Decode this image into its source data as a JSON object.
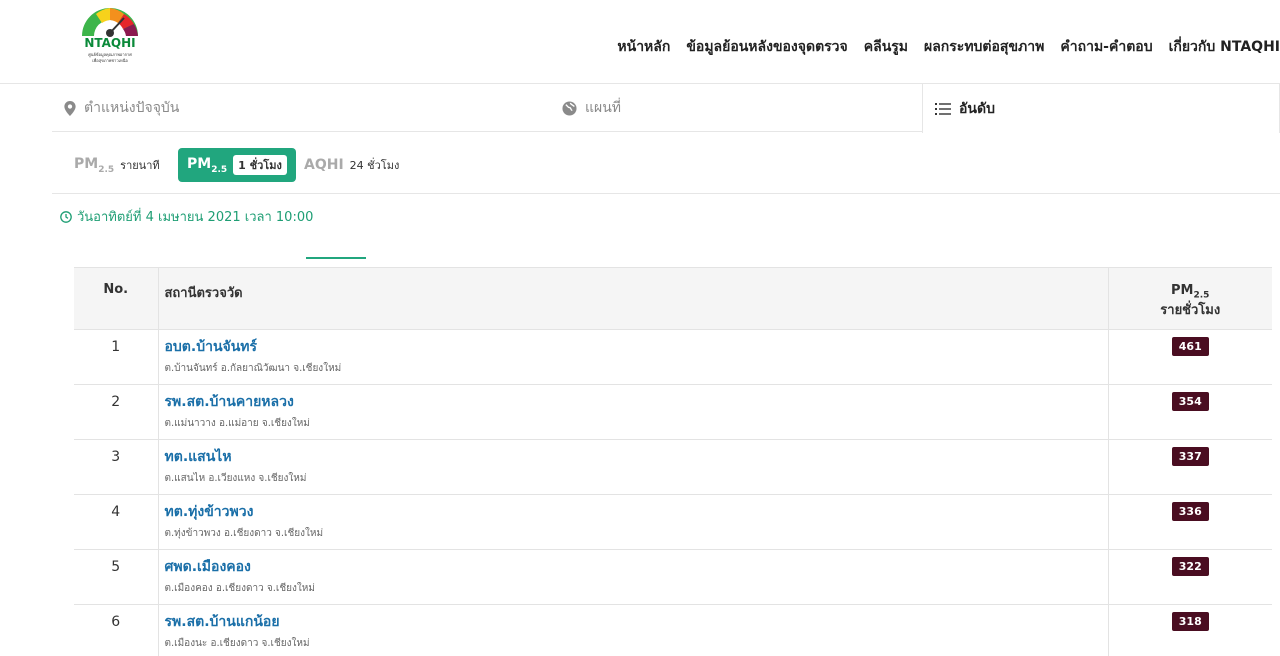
{
  "brand": {
    "logo_text": "NTAQHI",
    "logo_sub1": "ศูนย์ข้อมูลคุณภาพอากาศ",
    "logo_sub2": "เพื่อสุขภาพชาวเหนือ"
  },
  "nav": [
    "หน้าหลัก",
    "ข้อมูลย้อนหลังของจุดตรวจ",
    "คลีนรูม",
    "ผลกระทบต่อสุขภาพ",
    "คำถาม-คำตอบ",
    "เกี่ยวกับ NTAQHI"
  ],
  "top_tabs": [
    {
      "label": "ตำแหน่งปัจจุบัน",
      "icon": "map-marker-icon"
    },
    {
      "label": "แผนที่",
      "icon": "globe-icon"
    },
    {
      "label": "อันดับ",
      "icon": "list-icon",
      "active": true
    }
  ],
  "sub_tabs": [
    {
      "big": "PM",
      "sub": "2.5",
      "small": "รายนาที"
    },
    {
      "big": "PM",
      "sub": "2.5",
      "small": "1 ชั่วโมง",
      "active": true
    },
    {
      "big": "AQHI",
      "sub": "",
      "small": "24 ชั่วโมง"
    }
  ],
  "datetime": "วันอาทิตย์ที่ 4 เมษายน 2021 เวลา 10:00",
  "table": {
    "headers": {
      "no": "No.",
      "station": "สถานีตรวจวัด",
      "pm_big": "PM",
      "pm_sub": "2.5",
      "pm_line2": "รายชั่วโมง"
    },
    "rows": [
      {
        "no": "1",
        "name": "อบต.บ้านจันทร์",
        "addr": "ต.บ้านจันทร์ อ.กัลยาณิวัฒนา จ.เชียงใหม่",
        "value": "461"
      },
      {
        "no": "2",
        "name": "รพ.สต.บ้านคายหลวง",
        "addr": "ต.แม่นาวาง อ.แม่อาย จ.เชียงใหม่",
        "value": "354"
      },
      {
        "no": "3",
        "name": "ทต.แสนไห",
        "addr": "ต.แสนไห อ.เวียงแหง จ.เชียงใหม่",
        "value": "337"
      },
      {
        "no": "4",
        "name": "ทต.ทุ่งข้าวพวง",
        "addr": "ต.ทุ่งข้าวพวง อ.เชียงดาว จ.เชียงใหม่",
        "value": "336"
      },
      {
        "no": "5",
        "name": "ศพด.เมืองคอง",
        "addr": "ต.เมืองคอง อ.เชียงดาว จ.เชียงใหม่",
        "value": "322"
      },
      {
        "no": "6",
        "name": "รพ.สต.บ้านแกน้อย",
        "addr": "ต.เมืองนะ อ.เชียงดาว จ.เชียงใหม่",
        "value": "318"
      }
    ]
  },
  "colors": {
    "accent": "#21a67e",
    "badge": "#4a0d21",
    "link": "#1a6fa8"
  }
}
